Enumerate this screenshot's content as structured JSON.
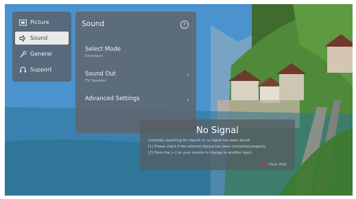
{
  "sidebar": {
    "items": [
      {
        "label": "Picture",
        "icon": "picture-icon"
      },
      {
        "label": "Sound",
        "icon": "speaker-icon"
      },
      {
        "label": "General",
        "icon": "wrench-icon"
      },
      {
        "label": "Support",
        "icon": "headset-icon"
      }
    ],
    "active_index": 1
  },
  "sound_panel": {
    "title": "Sound",
    "help_icon": "help-icon",
    "rows": [
      {
        "label": "Select Mode",
        "sub": "Standard",
        "has_chevron": false
      },
      {
        "label": "Sound Out",
        "sub": "TV Speaker",
        "has_chevron": true
      },
      {
        "label": "Advanced Settings",
        "sub": "",
        "has_chevron": true
      }
    ]
  },
  "no_signal": {
    "title": "No Signal",
    "lines": [
      "Currently searching for signals or no signal has been found.",
      "[1] Please check if the external device has been connected properly.",
      "[2] Press the [←] on your remote to change to another input."
    ],
    "button_label": "Close Help"
  },
  "colors": {
    "panel": "#5f646a",
    "active_item_bg": "#e9eaec",
    "accent_red": "#c4362f",
    "sky": "#4a93cf",
    "lake": "#2f7396"
  }
}
